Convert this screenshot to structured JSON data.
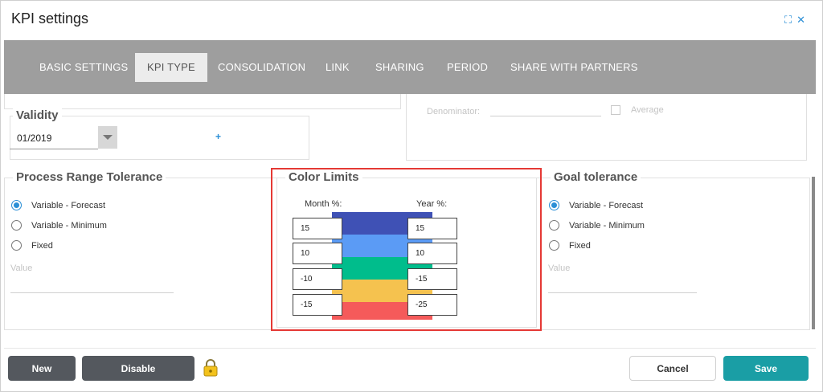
{
  "window": {
    "title": "KPI settings",
    "icons": [
      "expand-icon",
      "close-icon"
    ]
  },
  "tabs": [
    {
      "label": "BASIC SETTINGS",
      "active": false
    },
    {
      "label": "KPI TYPE",
      "active": true
    },
    {
      "label": "CONSOLIDATION",
      "active": false
    },
    {
      "label": "LINK",
      "active": false
    },
    {
      "label": "SHARING",
      "active": false
    },
    {
      "label": "PERIOD",
      "active": false
    },
    {
      "label": "SHARE WITH PARTNERS",
      "active": false
    }
  ],
  "validity": {
    "legend": "Validity",
    "value": "01/2019",
    "add_symbol": "+"
  },
  "right_panel": {
    "denominator_label": "Denominator:",
    "average_label": "Average"
  },
  "process_range": {
    "legend": "Process Range Tolerance",
    "options": [
      "Variable - Forecast",
      "Variable - Minimum",
      "Fixed"
    ],
    "selected": 0,
    "value_placeholder": "Value"
  },
  "color_limits": {
    "legend": "Color Limits",
    "month_label": "Month %:",
    "year_label": "Year %:",
    "month_values": [
      "15",
      "10",
      "-10",
      "-15"
    ],
    "year_values": [
      "15",
      "10",
      "-15",
      "-25"
    ],
    "band_colors": [
      "#3f51b5",
      "#5b9bf5",
      "#00bd8c",
      "#f5c24f",
      "#f55a5a"
    ]
  },
  "goal_tolerance": {
    "legend": "Goal tolerance",
    "options": [
      "Variable - Forecast",
      "Variable - Minimum",
      "Fixed"
    ],
    "selected": 0,
    "value_placeholder": "Value"
  },
  "footer": {
    "new_label": "New",
    "disable_label": "Disable",
    "cancel_label": "Cancel",
    "save_label": "Save"
  },
  "colors": {
    "accent": "#2b8fd6",
    "highlight_border": "#e53935",
    "save": "#1a9ea5",
    "dark_button": "#54585e",
    "tabbar": "#9e9e9e"
  }
}
